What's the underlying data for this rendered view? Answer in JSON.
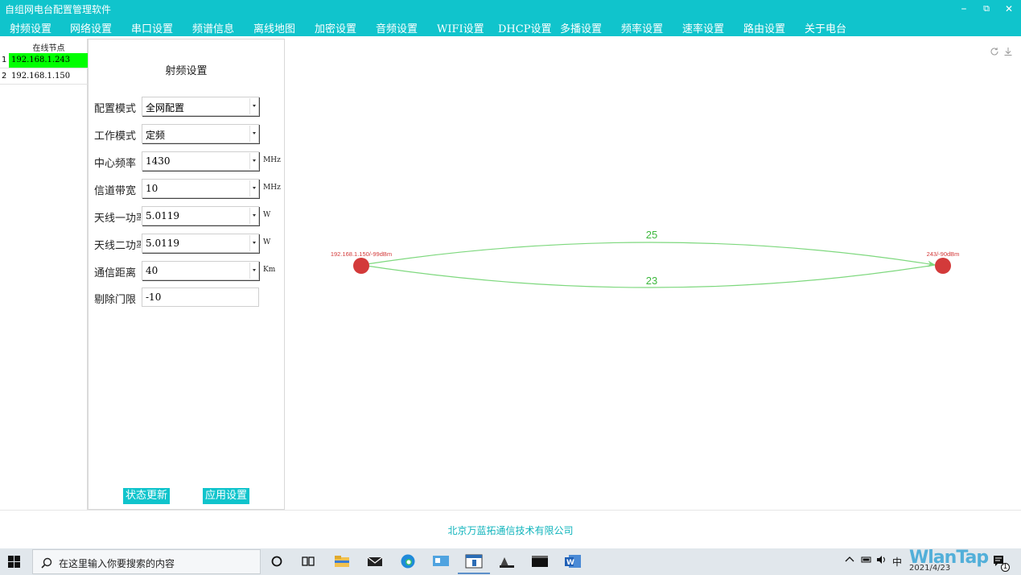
{
  "window": {
    "title": "自组网电台配置管理软件",
    "controls": {
      "minimize": "–",
      "restore": "⧉",
      "close": "✕"
    }
  },
  "menu": [
    "射频设置",
    "网络设置",
    "串口设置",
    "频谱信息",
    "离线地图",
    "加密设置",
    "音频设置",
    "WIFI设置",
    "DHCP设置",
    "多播设置",
    "频率设置",
    "速率设置",
    "路由设置",
    "关于电台"
  ],
  "nodes": {
    "header": "在线节点",
    "items": [
      {
        "index": "1",
        "ip": "192.168.1.243",
        "selected": true
      },
      {
        "index": "2",
        "ip": "192.168.1.150",
        "selected": false
      }
    ]
  },
  "panel": {
    "title": "射频设置",
    "fields": [
      {
        "label": "配置模式",
        "value": "全网配置",
        "dropdown": true,
        "unit": ""
      },
      {
        "label": "工作模式",
        "value": "定频",
        "dropdown": true,
        "unit": ""
      },
      {
        "label": "中心频率",
        "value": "1430",
        "dropdown": true,
        "unit": "MHz"
      },
      {
        "label": "信道带宽",
        "value": "10",
        "dropdown": true,
        "unit": "MHz"
      },
      {
        "label": "天线一功率",
        "value": "5.0119",
        "dropdown": true,
        "unit": "W"
      },
      {
        "label": "天线二功率",
        "value": "5.0119",
        "dropdown": true,
        "unit": "W"
      },
      {
        "label": "通信距离",
        "value": "40",
        "dropdown": true,
        "unit": "Km"
      },
      {
        "label": "剔除门限",
        "value": "-10",
        "dropdown": false,
        "unit": ""
      }
    ],
    "buttons": {
      "refresh": "状态更新",
      "apply": "应用设置"
    }
  },
  "topology": {
    "toolbar": {
      "refresh_icon": "refresh-icon",
      "save_icon": "download-icon"
    },
    "node_color": "#d33a3a",
    "link_color": "#7ed87e",
    "link_label_color": "#3cb83c",
    "nodes": [
      {
        "label": "192.168.1.150/-99dBm"
      },
      {
        "label": "243/-90dBm"
      }
    ],
    "links": [
      {
        "label": "25",
        "direction": "150 to 243"
      },
      {
        "label": "23",
        "direction": "243 to 150"
      }
    ]
  },
  "footer": {
    "company": "北京万蓝拓通信技术有限公司"
  },
  "taskbar": {
    "search_placeholder": "在这里输入你要搜索的内容",
    "tray_ime": "中",
    "tray_date": "2021/4/23",
    "watermark": "WlanTap",
    "notification_count": "1"
  },
  "colors": {
    "accent": "#10c4cc",
    "selected_row": "#00ff00"
  }
}
